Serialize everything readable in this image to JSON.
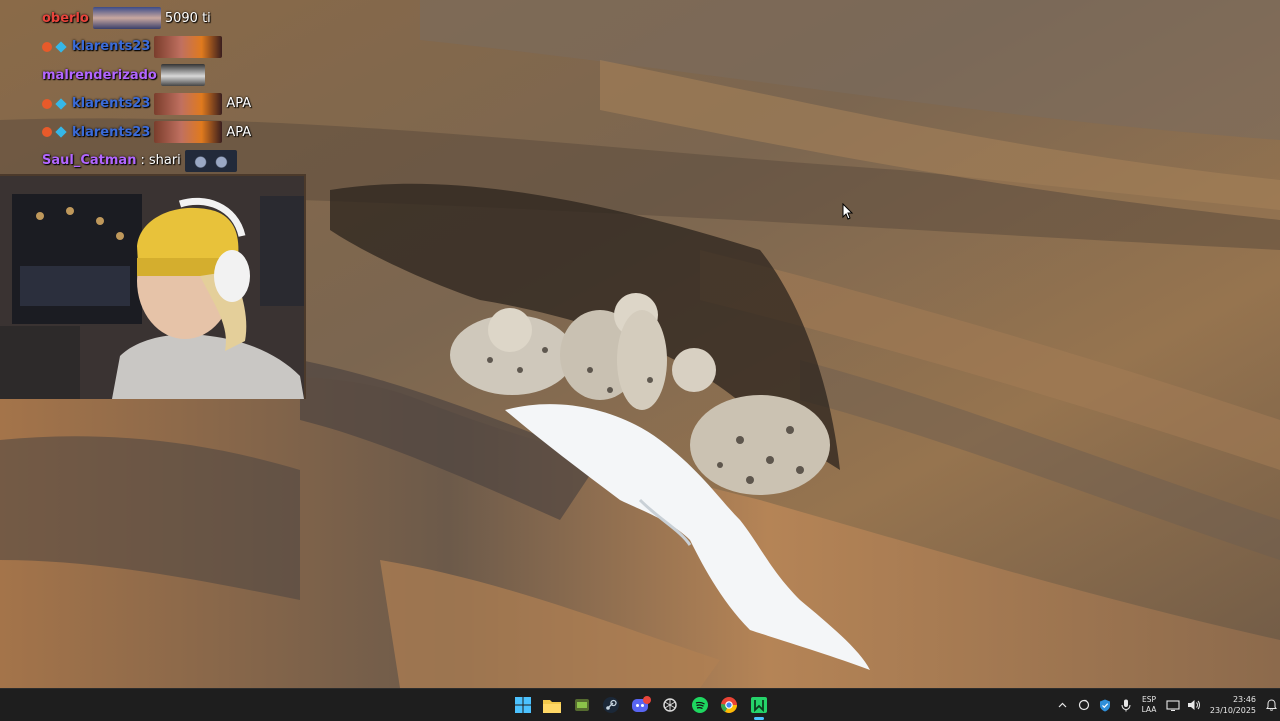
{
  "chat": {
    "messages": [
      {
        "user": "oberlo",
        "user_color": "#e8453c",
        "badges": [],
        "emote": "wide",
        "text": "5090 ti"
      },
      {
        "user": "klarents23",
        "user_color": "#3b6bd8",
        "badges": [
          "red-dot",
          "blue-gem"
        ],
        "emote": "fire",
        "text": ""
      },
      {
        "user": "malrenderizado",
        "user_color": "#b266ff",
        "badges": [],
        "emote": "car",
        "text": ""
      },
      {
        "user": "klarents23",
        "user_color": "#3b6bd8",
        "badges": [
          "red-dot",
          "blue-gem"
        ],
        "emote": "fire",
        "text": "APA"
      },
      {
        "user": "klarents23",
        "user_color": "#3b6bd8",
        "badges": [
          "red-dot",
          "blue-gem"
        ],
        "emote": "fire",
        "text": "APA"
      },
      {
        "user": "Saul_Catman",
        "user_color": "#b266ff",
        "badges": [],
        "emote": "",
        "text": "shari",
        "emote_after": "cats"
      }
    ]
  },
  "taskbar": {
    "apps": [
      {
        "name": "windows-start-icon",
        "color": "#4cc2ff"
      },
      {
        "name": "file-explorer-icon",
        "color": "#f2c84b"
      },
      {
        "name": "game-app-icon",
        "color": "#8bc34a"
      },
      {
        "name": "steam-icon",
        "color": "#c7d5e0"
      },
      {
        "name": "discord-icon",
        "color": "#5865f2",
        "badge": "9+"
      },
      {
        "name": "chatgpt-icon",
        "color": "#d8d8d8"
      },
      {
        "name": "spotify-icon",
        "color": "#1ed760"
      },
      {
        "name": "chrome-icon",
        "color": "#ea4335"
      },
      {
        "name": "obs-green-icon",
        "color": "#25d36a",
        "active": true
      }
    ],
    "tray": {
      "lang_line1": "ESP",
      "lang_line2": "LAA",
      "time": "23:46",
      "date": "23/10/2025"
    }
  }
}
